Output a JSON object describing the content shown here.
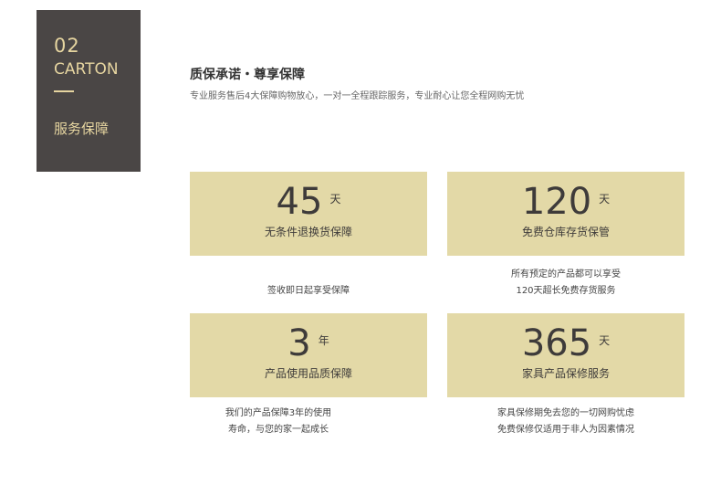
{
  "badge": {
    "number": "02",
    "english": "CARTON",
    "chinese": "服务保障"
  },
  "heading": "质保承诺・尊享保障",
  "subheading": "专业服务售后4大保障购物放心，一对一全程跟踪服务，专业耐心让您全程网购无忧",
  "cards": [
    {
      "value": "45",
      "unit": "天",
      "label": "无条件退换货保障",
      "desc": [
        "签收即日起享受保障"
      ]
    },
    {
      "value": "120",
      "unit": "天",
      "label": "免费仓库存货保管",
      "desc": [
        "所有预定的产品都可以享受",
        "120天超长免费存货服务"
      ]
    },
    {
      "value": "3",
      "unit": "年",
      "label": "产品使用品质保障",
      "desc": [
        "我们的产品保障3年的使用",
        "寿命，与您的家一起成长"
      ]
    },
    {
      "value": "365",
      "unit": "天",
      "label": "家具产品保修服务",
      "desc": [
        "家具保修期免去您的一切网购忧虑",
        "免费保修仅适用于非人为因素情况"
      ]
    }
  ],
  "colors": {
    "badge_bg": "#4a4645",
    "badge_text": "#e6d5a0",
    "card_bg": "#e3d9a7"
  }
}
